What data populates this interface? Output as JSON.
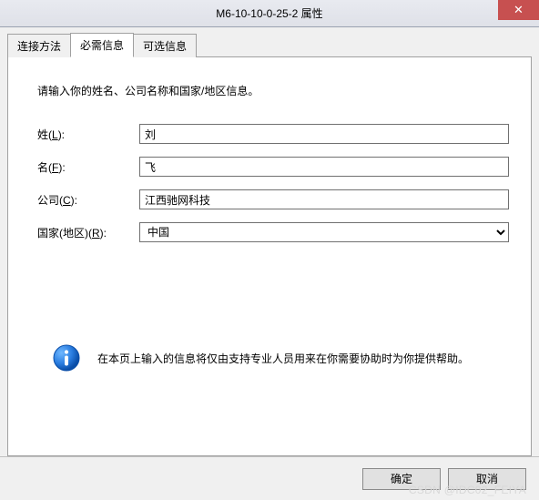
{
  "title": "M6-10-10-0-25-2 属性",
  "close_symbol": "✕",
  "tabs": {
    "t0": "连接方法",
    "t1": "必需信息",
    "t2": "可选信息"
  },
  "instruction": "请输入你的姓名、公司名称和国家/地区信息。",
  "labels": {
    "last_name": "姓(L):",
    "first_name": "名(F):",
    "company": "公司(C):",
    "country": "国家(地区)(R):"
  },
  "values": {
    "last_name": "刘",
    "first_name": "飞",
    "company": "江西驰网科技",
    "country": "中国"
  },
  "info_text": "在本页上输入的信息将仅由支持专业人员用来在你需要协助时为你提供帮助。",
  "buttons": {
    "ok": "确定",
    "cancel": "取消"
  },
  "watermark": "CSDN @IDC02_FEIYA"
}
